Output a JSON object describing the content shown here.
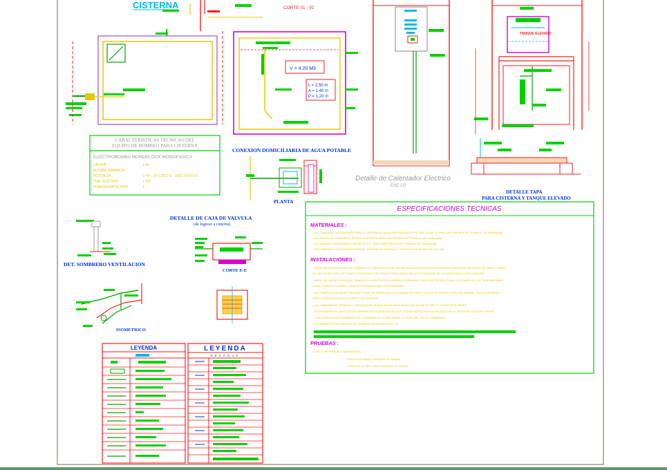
{
  "titles": {
    "cisterna": "CISTERNA",
    "corte": "CORTE 01 - 01",
    "volumen": "V = 4.20 M3",
    "dim_l": "L = 2.50 m",
    "dim_a": "A = 1.40 m",
    "dim_p": "P = 1.20 m",
    "tanque_label": "TANQUE ELEVADO",
    "caracteristicas_1": "CARACTERISTICAS TECNICAS DEL",
    "caracteristicas_2": "EQUIPO DE BOMBEO PARA CISTERNA",
    "electrobomba": "ELECTROBOMBA MONOBLOCK MONOFASICA",
    "spec_caudal": "CAUDAL :",
    "spec_caudal_v": "1 lt/s",
    "spec_altura": "ALTURA DINAMICA :",
    "spec_potencia": "POTENCIA :",
    "spec_potencia_v": "1 HP - 3/4 COLD S - 3500 VOLTIOS",
    "spec_succion": "TUB. SUCCION :",
    "spec_succion_v": "1 1/4\"",
    "spec_impulsion": "TUBERIA IMPULSION :",
    "spec_impulsion_v": "1\"",
    "conexion": "CONEXION DOMICILIARIA DE AGUA POTABLE",
    "planta": "PLANTA",
    "detalle_calentador": "Detalle de Calentador Electrico",
    "esc": "ESC 1/2",
    "detalle_tapa_1": "DETALLE TAPA",
    "detalle_tapa_2": "PARA CISTERNA Y TANQUE ELEVADO",
    "detalle_caja_1": "DETALLE DE CAJA DE VALVULA",
    "detalle_caja_2": "(de Ingreso a cisterna)",
    "corte_ee": "CORTE E-E",
    "sombrero": "DET. SOMBRERO VENTILACION",
    "isometrico": "ISOMETRICO",
    "leyenda": "LEYENDA",
    "desague": "DESAGUE"
  },
  "specs": {
    "title": "ESPECIFICACIONES      TECNICAS",
    "materiales": "MATERIALES :",
    "mat_lines": [
      "- LAS TUBERIAS Y ACCESORIOS PARA EL SISTEMA DE AGUA FRIA SERAN DE PVC-SAP CLASE 10 PARA UNA PRESION DE TRABAJO DE 150lbs/pulg2",
      "- LAS VALVULAS COMPUERTA SERAN DE BRONCE PARA UNA PRESION DE TRABAJO DE 150lbs/pulg2",
      "- LAS UNIONES UNIVERSALES SERAN DE F.G. PARA UNA PRESION DE TRABAJO DE 150lbs/pulg2",
      "- LAS TUBERIAS Y ACCESORIOS PARA EL SISTEMA DE DESAGUE Y VENTILACION SERAN DE PVC-SAL"
    ],
    "instalaciones": "INSTALACIONES :",
    "inst_lines": [
      "- ANTES DE LA EJECUCION DEL TRABAJO EL CONTRATISTA DE LAS INSTALACIONES SANITARIAS DEBERA VERIFICAR LAS COTAS DE TAPA Y FONDO",
      "  DE LAS CAJAS CON LOS PLANOS TOPOGRAFICOS FINALES PARA VERIFICAR LA FACTIBILIDAD DE LA CONEXION A LA RED PUBLICA",
      "- ANTES DE LA EJECUCION DEL TRABAJO EL CONTRATISTA DEBERA COORDINAR CON EL ING ESTRUCTURAL LOS PASES DE LAS TUBERIAS PARA",
      "  VIGAS, ZAPATAS Y MUROS , ANALIS DE DIMENSIONES DE PASADORES",
      "- LAS TUBERIAS DE AGUA FRIA A EMPOTRAR SE INSTALARAN EN CANALETAS PRACTICADAS EN MUROS PARA A DE MUROS , CUYA DIMENSION",
      "  SERA LA NECESARIA PARA CUBRIR LAS TUBERIAS",
      "- LAS TUBERIAS DE DESAGUE Y VENTILACION SERAN INSTALADAS ANTES DE VACIAR EL PISO O LEVANTAR EL MURO",
      "- TODA TUBERIA DE VENTILACION DEBERA INSTALARSE ENTRE DOS CODOS ESPECIALES INSTALADOS EN EL MURO DE CADA TIPO MEDIO",
      "- TODO VENTILADOR TERMINARA EN SOMBRERETE A 0.30m SOBRE EL NIVEL DEL TECHO TERMINADO",
      "- LA PENDIENTE DE TUBERIAS DE DESAGUE SERA MINIMO DE 1%"
    ],
    "pruebas": "PRUEBAS :",
    "pruebas_lines": [
      "- EJECUTAR PRUEBAS HIDRAULICAS",
      "- AGUA A 100 lb/pulg2 DURANTE 15 minutos",
      "- DESAGUE A TUBO LLENO DURANTE 24 HORAS"
    ]
  }
}
